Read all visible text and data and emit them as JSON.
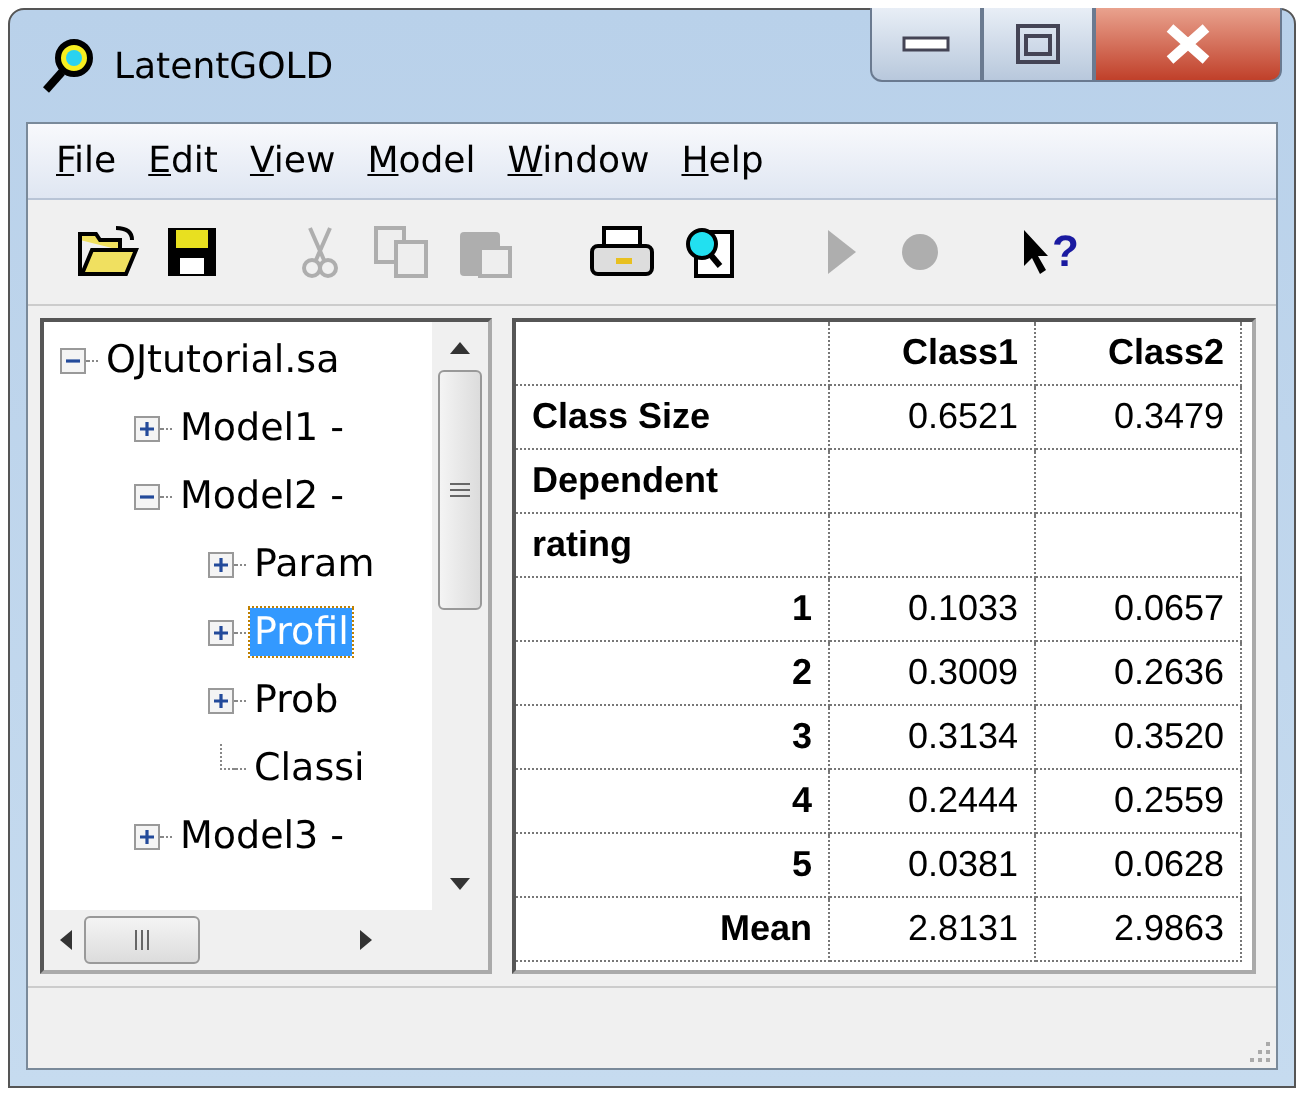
{
  "window": {
    "title": "LatentGOLD"
  },
  "menu": [
    {
      "label": "File"
    },
    {
      "label": "Edit"
    },
    {
      "label": "View"
    },
    {
      "label": "Model"
    },
    {
      "label": "Window"
    },
    {
      "label": "Help"
    }
  ],
  "toolbar": [
    {
      "kind": "open",
      "disabled": false
    },
    {
      "kind": "save",
      "disabled": false
    },
    {
      "kind": "sep"
    },
    {
      "kind": "cut",
      "disabled": true
    },
    {
      "kind": "copy",
      "disabled": true
    },
    {
      "kind": "paste",
      "disabled": true
    },
    {
      "kind": "sep"
    },
    {
      "kind": "print",
      "disabled": false
    },
    {
      "kind": "preview",
      "disabled": false
    },
    {
      "kind": "sep"
    },
    {
      "kind": "play",
      "disabled": true
    },
    {
      "kind": "stop",
      "disabled": true
    },
    {
      "kind": "sep"
    },
    {
      "kind": "help",
      "disabled": false,
      "label": "?"
    }
  ],
  "tree": [
    {
      "label": "OJtutorial.sa",
      "expanded": true,
      "selected": false,
      "children": [
        {
          "label": "Model1 -",
          "expanded": false,
          "selected": false
        },
        {
          "label": "Model2 -",
          "expanded": true,
          "selected": false,
          "children": [
            {
              "label": "Param",
              "expanded": false,
              "selected": false
            },
            {
              "label": "Profil",
              "expanded": false,
              "selected": true
            },
            {
              "label": "Prob",
              "expanded": false,
              "selected": false
            },
            {
              "label": "Classi",
              "selected": false
            }
          ]
        },
        {
          "label": "Model3 -",
          "expanded": false,
          "selected": false
        }
      ]
    }
  ],
  "table": {
    "columns": [
      "Class1",
      "Class2"
    ],
    "rows": [
      {
        "label": "Class Size",
        "kind": "section",
        "values": [
          "0.6521",
          "0.3479"
        ]
      },
      {
        "label": "Dependent",
        "kind": "section"
      },
      {
        "label": "rating",
        "kind": "section"
      },
      {
        "label": "1",
        "kind": "level",
        "values": [
          "0.1033",
          "0.0657"
        ]
      },
      {
        "label": "2",
        "kind": "level",
        "values": [
          "0.3009",
          "0.2636"
        ]
      },
      {
        "label": "3",
        "kind": "level",
        "values": [
          "0.3134",
          "0.3520"
        ]
      },
      {
        "label": "4",
        "kind": "level",
        "values": [
          "0.2444",
          "0.2559"
        ]
      },
      {
        "label": "5",
        "kind": "level",
        "values": [
          "0.0381",
          "0.0628"
        ]
      },
      {
        "label": "Mean",
        "kind": "level",
        "values": [
          "2.8131",
          "2.9863"
        ]
      }
    ]
  }
}
